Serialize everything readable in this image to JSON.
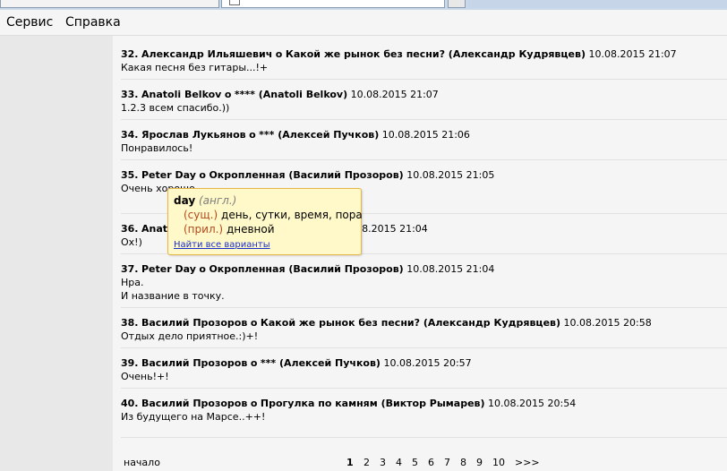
{
  "menu": {
    "items": [
      "Сервис",
      "Справка"
    ]
  },
  "comments": [
    {
      "num": "32.",
      "author": "Александр Ильяшевич",
      "sep": "о",
      "title": "Какой же рынок без песни? (Александр Кудрявцев)",
      "date": "10.08.2015 21:07",
      "lines": [
        "Какая песня без гитары...!+"
      ]
    },
    {
      "num": "33.",
      "author": "Anatoli Belkov",
      "sep": "о",
      "title": "**** (Anatoli Belkov)",
      "date": "10.08.2015 21:07",
      "lines": [
        "1.2.3 всем спасибо.))"
      ]
    },
    {
      "num": "34.",
      "author": "Ярослав Лукьянов",
      "sep": "о",
      "title": "*** (Алексей Пучков)",
      "date": "10.08.2015 21:06",
      "lines": [
        "Понравилось!"
      ]
    },
    {
      "num": "35.",
      "author": "Peter Day",
      "sep": "о",
      "title": "Окропленная (Василий Прозоров)",
      "date": "10.08.2015 21:05",
      "lines": [
        "Очень хорошо"
      ]
    },
    {
      "num": "36.",
      "author": "Anato",
      "sep": "",
      "title": "",
      "date": "10.08.2015 21:04",
      "lines": [
        "Ох!)"
      ]
    },
    {
      "num": "37.",
      "author": "Peter Day",
      "sep": "о",
      "title": "Окропленная (Василий Прозоров)",
      "date": "10.08.2015 21:04",
      "lines": [
        "Нра.",
        "И название в точку."
      ]
    },
    {
      "num": "38.",
      "author": "Василий Прозоров",
      "sep": "о",
      "title": "Какой же рынок без песни? (Александр Кудрявцев)",
      "date": "10.08.2015 20:58",
      "lines": [
        "Отдых дело приятное.:)+!"
      ]
    },
    {
      "num": "39.",
      "author": "Василий Прозоров",
      "sep": "о",
      "title": "*** (Алексей Пучков)",
      "date": "10.08.2015 20:57",
      "lines": [
        "Очень!+!"
      ]
    },
    {
      "num": "40.",
      "author": "Василий Прозоров",
      "sep": "о",
      "title": "Прогулка по камням (Виктор Рымарев)",
      "date": "10.08.2015 20:54",
      "lines": [
        "Из будущего на Марсе..++!"
      ]
    }
  ],
  "pager": {
    "start_label": "начало",
    "current": "1",
    "pages": [
      "1",
      "2",
      "3",
      "4",
      "5",
      "6",
      "7",
      "8",
      "9",
      "10"
    ],
    "next_label": ">>>"
  },
  "tooltip": {
    "word": "day",
    "lang": "(англ.)",
    "entries": [
      {
        "pos": "(сущ.)",
        "meaning": "день, сутки, время, пора"
      },
      {
        "pos": "(прил.)",
        "meaning": "дневной"
      }
    ],
    "link": "Найти все варианты"
  }
}
